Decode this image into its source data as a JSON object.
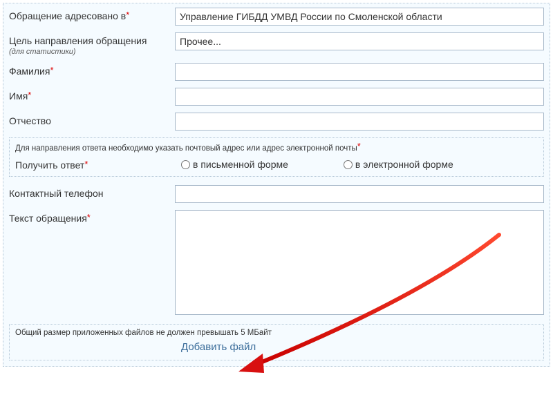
{
  "fields": {
    "addressed_to": {
      "label": "Обращение адресовано в",
      "value": "Управление ГИБДД УМВД России по Смоленской области"
    },
    "purpose": {
      "label": "Цель направления обращения",
      "sub": "(для статистики)",
      "value": "Прочее..."
    },
    "lastname": {
      "label": "Фамилия",
      "value": ""
    },
    "firstname": {
      "label": "Имя",
      "value": ""
    },
    "patronymic": {
      "label": "Отчество",
      "value": ""
    },
    "phone": {
      "label": "Контактный телефон",
      "value": ""
    },
    "text": {
      "label": "Текст обращения",
      "value": ""
    }
  },
  "response_block": {
    "title": "Для направления ответа необходимо указать почтовый адрес или адрес электронной почты",
    "label": "Получить ответ",
    "option_written": "в письменной форме",
    "option_email": "в электронной форме"
  },
  "file_block": {
    "title": "Общий размер приложенных файлов не должен превышать 5 МБайт",
    "add_label": "Добавить файл"
  }
}
